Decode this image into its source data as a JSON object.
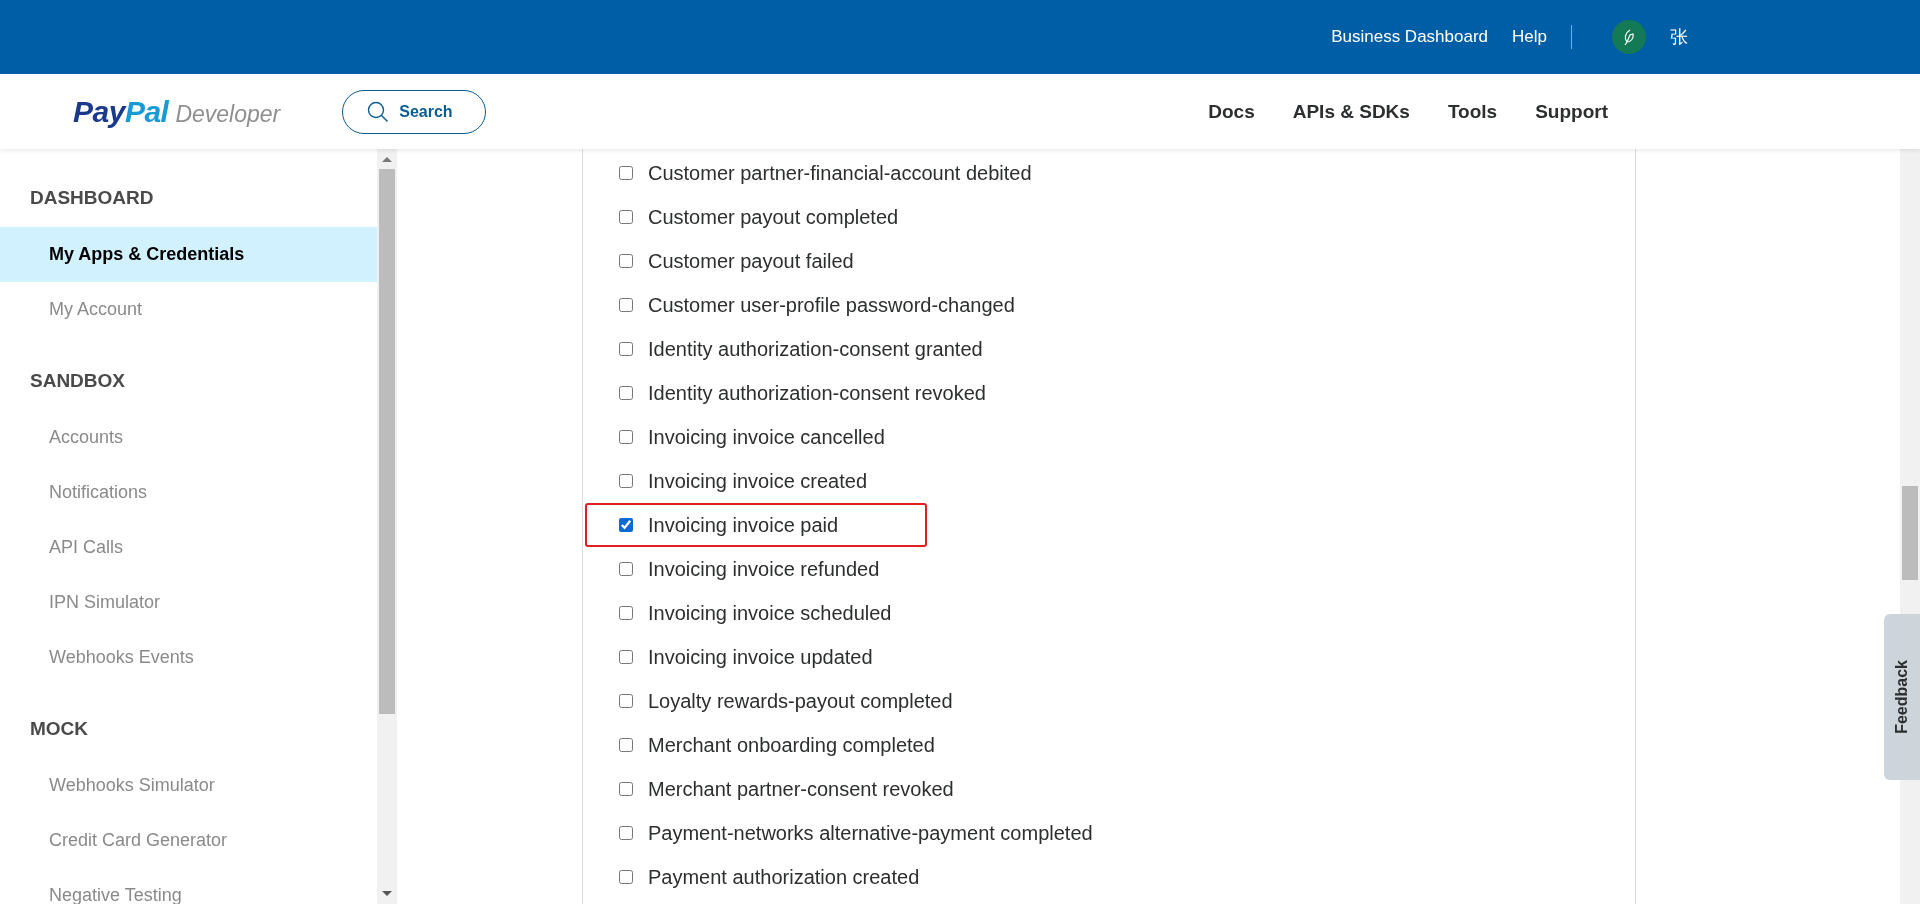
{
  "top_bar": {
    "links": [
      "Business Dashboard",
      "Help"
    ],
    "user": {
      "name": "张"
    }
  },
  "header": {
    "logo": {
      "brand_dark": "Pay",
      "brand_light": "Pal",
      "product": "Developer"
    },
    "search": {
      "label": "Search"
    },
    "nav": [
      "Docs",
      "APIs & SDKs",
      "Tools",
      "Support"
    ]
  },
  "sidebar": {
    "sections": [
      {
        "title": "DASHBOARD",
        "items": [
          {
            "label": "My Apps & Credentials",
            "selected": true
          },
          {
            "label": "My Account",
            "selected": false
          }
        ]
      },
      {
        "title": "SANDBOX",
        "items": [
          {
            "label": "Accounts",
            "selected": false
          },
          {
            "label": "Notifications",
            "selected": false
          },
          {
            "label": "API Calls",
            "selected": false
          },
          {
            "label": "IPN Simulator",
            "selected": false
          },
          {
            "label": "Webhooks Events",
            "selected": false
          }
        ]
      },
      {
        "title": "MOCK",
        "items": [
          {
            "label": "Webhooks Simulator",
            "selected": false
          },
          {
            "label": "Credit Card Generator",
            "selected": false
          },
          {
            "label": "Negative Testing",
            "selected": false
          }
        ]
      }
    ]
  },
  "events": [
    {
      "label": "Customer partner-financial-account debited",
      "checked": false,
      "highlighted": false
    },
    {
      "label": "Customer payout completed",
      "checked": false,
      "highlighted": false
    },
    {
      "label": "Customer payout failed",
      "checked": false,
      "highlighted": false
    },
    {
      "label": "Customer user-profile password-changed",
      "checked": false,
      "highlighted": false
    },
    {
      "label": "Identity authorization-consent granted",
      "checked": false,
      "highlighted": false
    },
    {
      "label": "Identity authorization-consent revoked",
      "checked": false,
      "highlighted": false
    },
    {
      "label": "Invoicing invoice cancelled",
      "checked": false,
      "highlighted": false
    },
    {
      "label": "Invoicing invoice created",
      "checked": false,
      "highlighted": false
    },
    {
      "label": "Invoicing invoice paid",
      "checked": true,
      "highlighted": true
    },
    {
      "label": "Invoicing invoice refunded",
      "checked": false,
      "highlighted": false
    },
    {
      "label": "Invoicing invoice scheduled",
      "checked": false,
      "highlighted": false
    },
    {
      "label": "Invoicing invoice updated",
      "checked": false,
      "highlighted": false
    },
    {
      "label": "Loyalty rewards-payout completed",
      "checked": false,
      "highlighted": false
    },
    {
      "label": "Merchant onboarding completed",
      "checked": false,
      "highlighted": false
    },
    {
      "label": "Merchant partner-consent revoked",
      "checked": false,
      "highlighted": false
    },
    {
      "label": "Payment-networks alternative-payment completed",
      "checked": false,
      "highlighted": false
    },
    {
      "label": "Payment authorization created",
      "checked": false,
      "highlighted": false
    }
  ],
  "feedback": {
    "label": "Feedback"
  }
}
